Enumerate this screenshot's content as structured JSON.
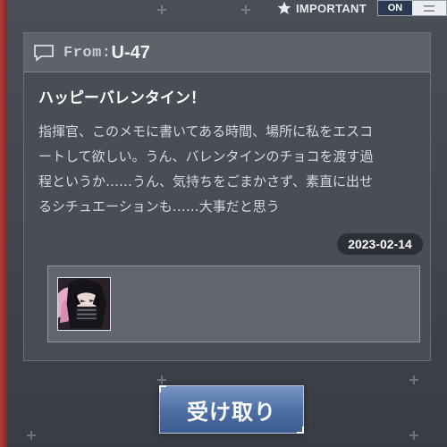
{
  "important": {
    "label": "IMPORTANT",
    "toggle_on": "ON",
    "icon": "star-icon",
    "off_icon": "menu-lines-icon"
  },
  "memo": {
    "from_prefix": "From:",
    "from_name": "U-47",
    "title": "ハッピーバレンタイン！",
    "body_lines": [
      "指揮官、このメモに書いてある時間、場所に私をエスコ",
      "ートして欲しい。うん、バレンタインのチョコを渡す過",
      "程というか……うん、気持ちをごまかさず、素直に出せ",
      "るシチュエーションも……大事だと思う"
    ],
    "date": "2023-02-14",
    "attachment_icon": "character-avatar"
  },
  "button": {
    "receive_label": "受け取り"
  },
  "colors": {
    "accent_blue": "#4d6ea4",
    "panel": "#4a4e57",
    "toggle_on": "#2b3a52",
    "side_red": "#b43a38"
  }
}
